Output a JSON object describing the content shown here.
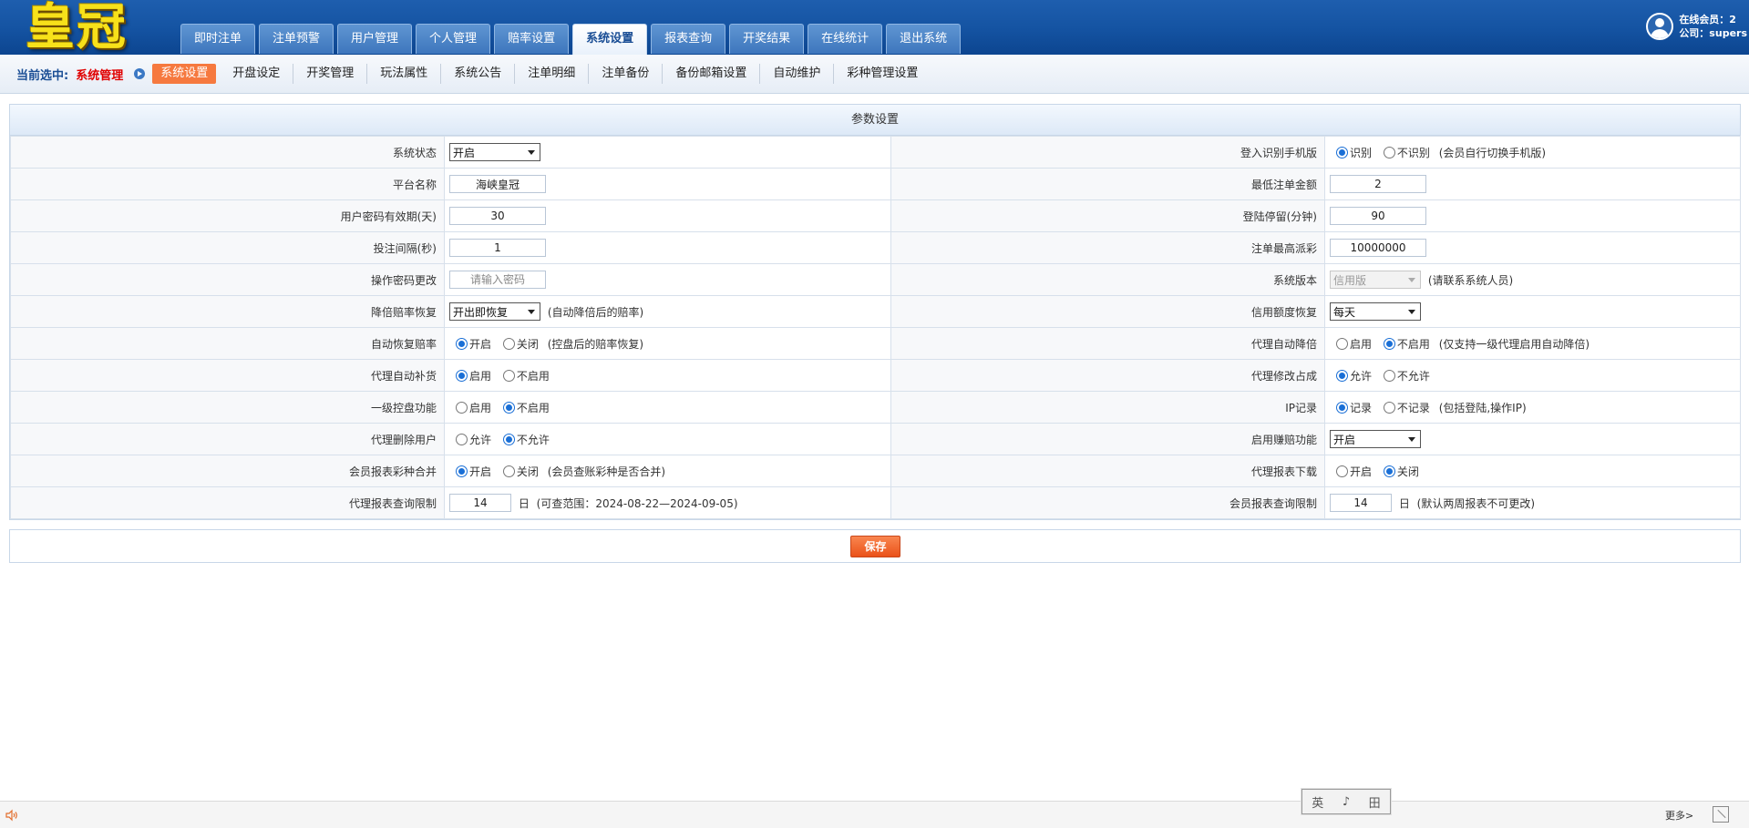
{
  "header": {
    "logo_text": "皇冠",
    "nav_tabs": [
      {
        "label": "即时注单"
      },
      {
        "label": "注单预警"
      },
      {
        "label": "用户管理"
      },
      {
        "label": "个人管理"
      },
      {
        "label": "赔率设置"
      },
      {
        "label": "系统设置",
        "active": true
      },
      {
        "label": "报表查询"
      },
      {
        "label": "开奖结果"
      },
      {
        "label": "在线统计"
      },
      {
        "label": "退出系统"
      }
    ],
    "online_members": "在线会员：2",
    "company": "公司：supers"
  },
  "subnav": {
    "current_label": "当前选中:",
    "current_value": "系统管理",
    "items": [
      {
        "label": "系统设置",
        "active": true
      },
      {
        "label": "开盘设定"
      },
      {
        "label": "开奖管理"
      },
      {
        "label": "玩法属性"
      },
      {
        "label": "系统公告"
      },
      {
        "label": "注单明细"
      },
      {
        "label": "注单备份"
      },
      {
        "label": "备份邮箱设置"
      },
      {
        "label": "自动维护"
      },
      {
        "label": "彩种管理设置"
      }
    ]
  },
  "panel": {
    "title": "参数设置",
    "system_status": {
      "label": "系统状态",
      "value": "开启"
    },
    "platform_name": {
      "label": "平台名称",
      "value": "海峡皇冠"
    },
    "pwd_validity": {
      "label": "用户密码有效期(天)",
      "value": "30"
    },
    "bet_interval": {
      "label": "投注间隔(秒)",
      "value": "1"
    },
    "op_pwd": {
      "label": "操作密码更改",
      "placeholder": "请输入密码"
    },
    "odds_restore": {
      "label": "降倍赔率恢复",
      "value": "开出即恢复",
      "note": "(自动降倍后的赔率)"
    },
    "auto_restore_odds": {
      "label": "自动恢复赔率",
      "opt1": "开启",
      "opt2": "关闭",
      "note": "(控盘后的赔率恢复)"
    },
    "agent_auto_fill": {
      "label": "代理自动补货",
      "opt1": "启用",
      "opt2": "不启用"
    },
    "level1_control": {
      "label": "一级控盘功能",
      "opt1": "启用",
      "opt2": "不启用"
    },
    "agent_delete_user": {
      "label": "代理删除用户",
      "opt1": "允许",
      "opt2": "不允许"
    },
    "member_report_merge": {
      "label": "会员报表彩种合并",
      "opt1": "开启",
      "opt2": "关闭",
      "note": "(会员查账彩种是否合并)"
    },
    "agent_report_limit": {
      "label": "代理报表查询限制",
      "value": "14",
      "unit": "日",
      "note": "(可查范围：2024-08-22—2024-09-05)"
    },
    "login_mobile": {
      "label": "登入识别手机版",
      "opt1": "识别",
      "opt2": "不识别",
      "note": "(会员自行切换手机版)"
    },
    "min_bet": {
      "label": "最低注单金额",
      "value": "2"
    },
    "login_stay": {
      "label": "登陆停留(分钟)",
      "value": "90"
    },
    "max_payout": {
      "label": "注单最高派彩",
      "value": "10000000"
    },
    "system_version": {
      "label": "系统版本",
      "value": "信用版",
      "note": "(请联系系统人员)"
    },
    "credit_restore": {
      "label": "信用额度恢复",
      "value": "每天"
    },
    "agent_auto_lower": {
      "label": "代理自动降倍",
      "opt1": "启用",
      "opt2": "不启用",
      "note": "(仅支持一级代理启用自动降倍)"
    },
    "agent_modify_share": {
      "label": "代理修改占成",
      "opt1": "允许",
      "opt2": "不允许"
    },
    "ip_record": {
      "label": "IP记录",
      "opt1": "记录",
      "opt2": "不记录",
      "note": "(包括登陆,操作IP)"
    },
    "enable_compensation": {
      "label": "启用赚赔功能",
      "value": "开启"
    },
    "agent_report_download": {
      "label": "代理报表下载",
      "opt1": "开启",
      "opt2": "关闭"
    },
    "member_report_limit": {
      "label": "会员报表查询限制",
      "value": "14",
      "unit": "日",
      "note": "(默认两周报表不可更改)"
    }
  },
  "save_label": "保存",
  "bottom": {
    "ime_ch1": "英",
    "ime_ch2": "♪",
    "ime_ch3": "⽥",
    "more_label": "更多>"
  },
  "colors": {
    "accent": "#1554a3",
    "active_sub": "#f6793f",
    "save": "#ea5119",
    "radio": "#1a6fd6"
  }
}
